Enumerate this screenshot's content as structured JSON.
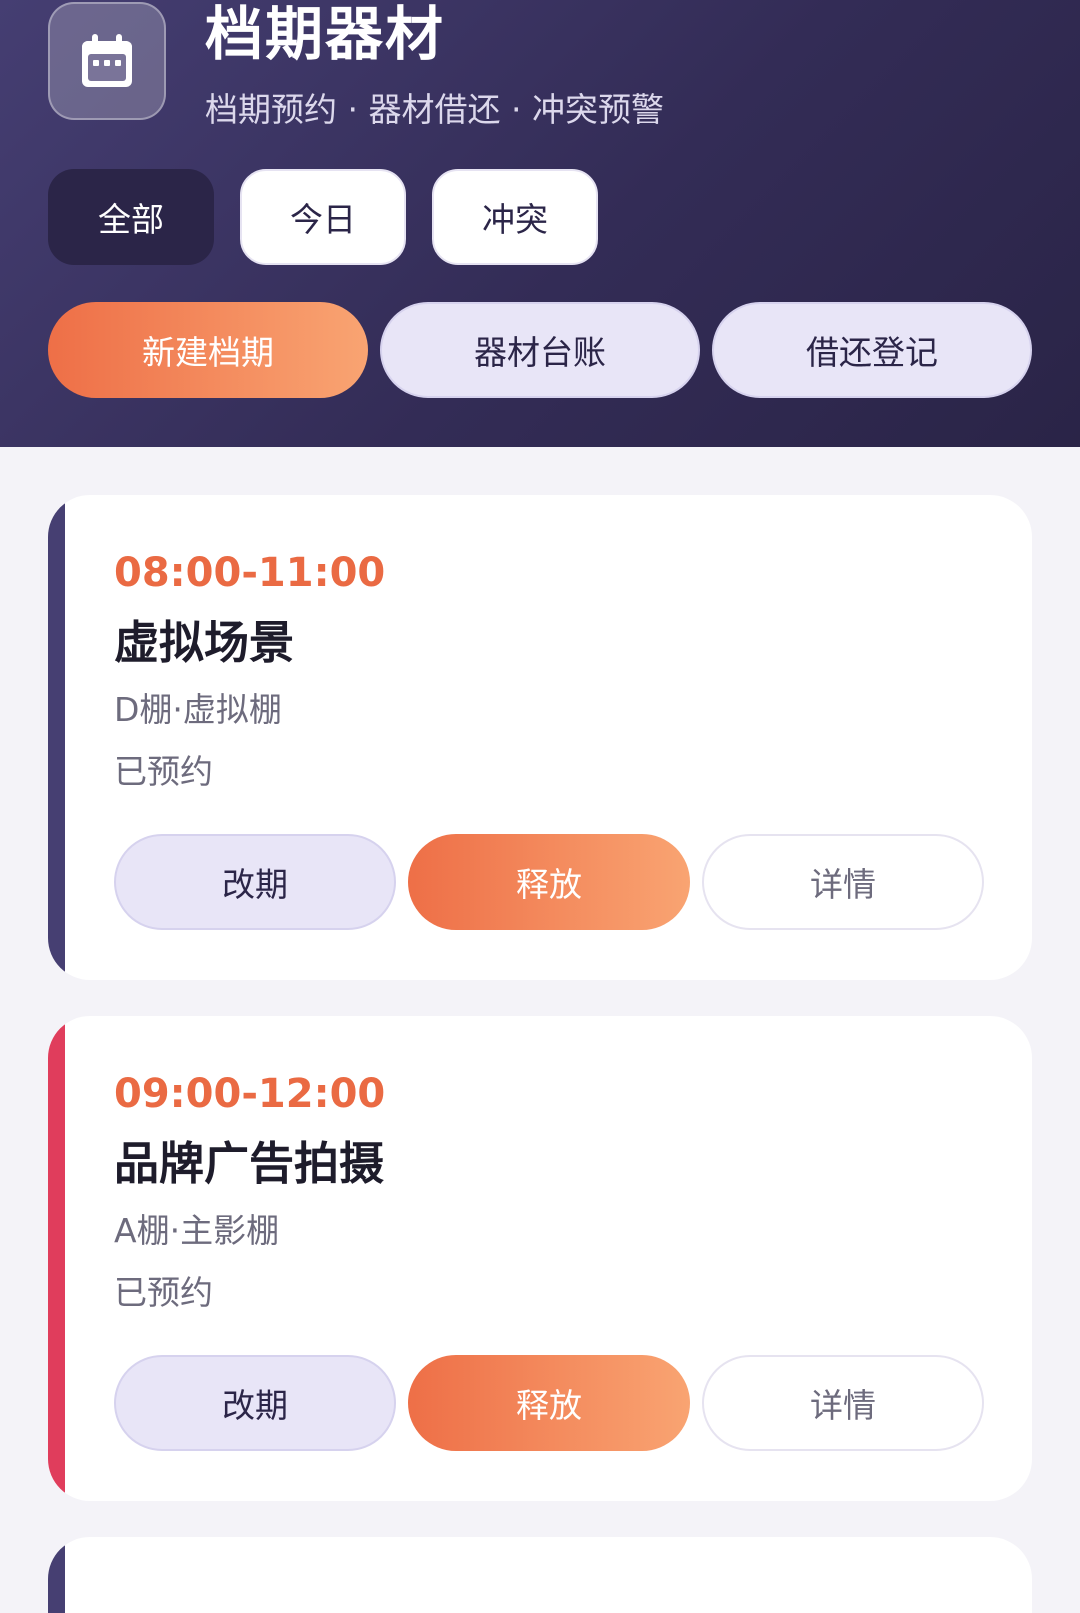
{
  "header": {
    "title": "档期器材",
    "subtitle": "档期预约 · 器材借还 · 冲突预警",
    "icon": "calendar-icon"
  },
  "filters": [
    {
      "label": "全部",
      "active": true
    },
    {
      "label": "今日",
      "active": false
    },
    {
      "label": "冲突",
      "active": false
    }
  ],
  "actions": [
    {
      "label": "新建档期"
    },
    {
      "label": "器材台账"
    },
    {
      "label": "借还登记"
    }
  ],
  "cards": [
    {
      "time": "08:00-11:00",
      "name": "虚拟场景",
      "location": "D棚·虚拟棚",
      "status": "已预约",
      "stripe_color": "#463f72",
      "buttons": {
        "reschedule": "改期",
        "release": "释放",
        "details": "详情"
      }
    },
    {
      "time": "09:00-12:00",
      "name": "品牌广告拍摄",
      "location": "A棚·主影棚",
      "status": "已预约",
      "stripe_color": "#e03d5c",
      "buttons": {
        "reschedule": "改期",
        "release": "释放",
        "details": "详情"
      }
    },
    {
      "stripe_color": "#463f72"
    }
  ],
  "colors": {
    "accent": "#ee6f47",
    "header_bg": "#3b3463",
    "dark": "#2b2548"
  }
}
